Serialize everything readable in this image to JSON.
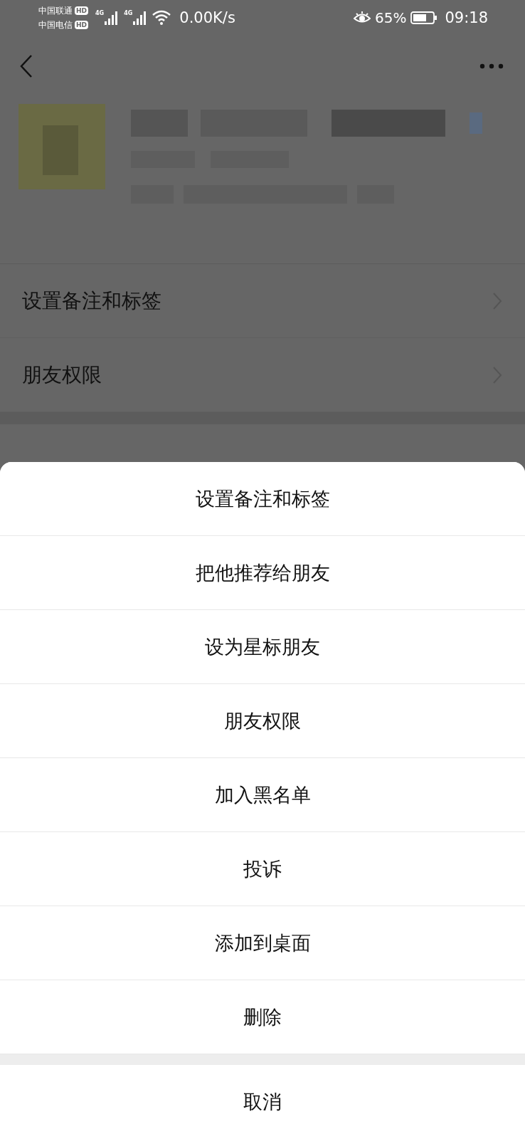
{
  "status_bar": {
    "carriers": [
      {
        "name": "中国联通",
        "badge": "HD"
      },
      {
        "name": "中国电信",
        "badge": "HD"
      }
    ],
    "networks": [
      "4G",
      "4G"
    ],
    "speed": "0.00K/s",
    "battery": "65%",
    "time": "09:18"
  },
  "settings_rows": [
    {
      "label": "设置备注和标签"
    },
    {
      "label": "朋友权限"
    }
  ],
  "action_sheet": {
    "items": [
      "设置备注和标签",
      "把他推荐给朋友",
      "设为星标朋友",
      "朋友权限",
      "加入黑名单",
      "投诉",
      "添加到桌面",
      "删除"
    ],
    "cancel": "取消"
  }
}
